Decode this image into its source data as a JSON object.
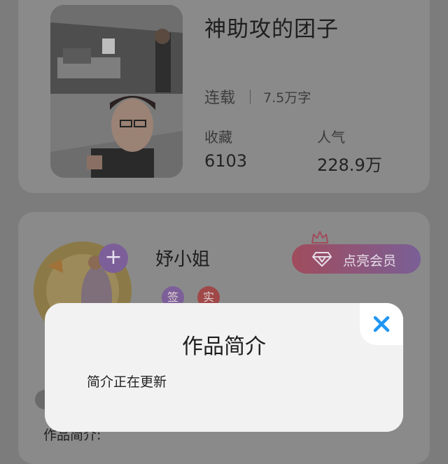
{
  "book": {
    "title": "神助攻的团子",
    "status": "连载",
    "word_count": "7.5万字",
    "favorites_label": "收藏",
    "favorites_value": "6103",
    "popularity_label": "人气",
    "popularity_value": "228.9万"
  },
  "author": {
    "name": "妤小姐",
    "follow_symbol": "+",
    "badges": [
      "签",
      "实"
    ],
    "vip_label": "点亮会员"
  },
  "peek": {
    "intro_label": "作品简介:"
  },
  "modal": {
    "title": "作品简介",
    "body": "简介正在更新"
  },
  "colors": {
    "overlay": "#7c7c7c",
    "modal_bg": "#f2f2f2",
    "close_icon": "#2196f3",
    "vip_gradient_start": "#a04c5d",
    "vip_gradient_end": "#7a5f96",
    "badge_sign": "#7c5f99",
    "badge_real": "#a04848"
  }
}
